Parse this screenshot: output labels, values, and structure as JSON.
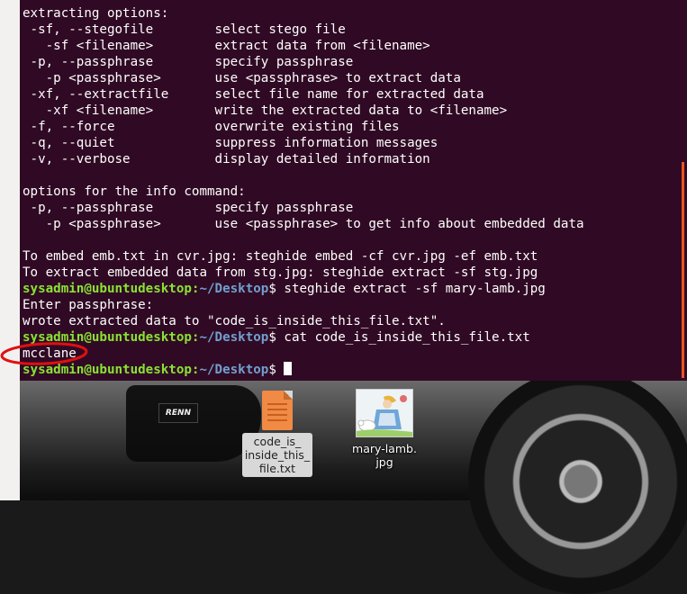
{
  "terminal": {
    "lines": [
      {
        "kind": "text",
        "text": "extracting options:"
      },
      {
        "kind": "text",
        "text": " -sf, --stegofile        select stego file"
      },
      {
        "kind": "text",
        "text": "   -sf <filename>        extract data from <filename>"
      },
      {
        "kind": "text",
        "text": " -p, --passphrase        specify passphrase"
      },
      {
        "kind": "text",
        "text": "   -p <passphrase>       use <passphrase> to extract data"
      },
      {
        "kind": "text",
        "text": " -xf, --extractfile      select file name for extracted data"
      },
      {
        "kind": "text",
        "text": "   -xf <filename>        write the extracted data to <filename>"
      },
      {
        "kind": "text",
        "text": " -f, --force             overwrite existing files"
      },
      {
        "kind": "text",
        "text": " -q, --quiet             suppress information messages"
      },
      {
        "kind": "text",
        "text": " -v, --verbose           display detailed information"
      },
      {
        "kind": "text",
        "text": ""
      },
      {
        "kind": "text",
        "text": "options for the info command:"
      },
      {
        "kind": "text",
        "text": " -p, --passphrase        specify passphrase"
      },
      {
        "kind": "text",
        "text": "   -p <passphrase>       use <passphrase> to get info about embedded data"
      },
      {
        "kind": "text",
        "text": ""
      },
      {
        "kind": "text",
        "text": "To embed emb.txt in cvr.jpg: steghide embed -cf cvr.jpg -ef emb.txt"
      },
      {
        "kind": "text",
        "text": "To extract embedded data from stg.jpg: steghide extract -sf stg.jpg"
      },
      {
        "kind": "prompt",
        "user": "sysadmin@ubuntudesktop",
        "path": "~/Desktop",
        "cmd": " steghide extract -sf mary-lamb.jpg"
      },
      {
        "kind": "text",
        "text": "Enter passphrase:"
      },
      {
        "kind": "text",
        "text": "wrote extracted data to \"code_is_inside_this_file.txt\"."
      },
      {
        "kind": "prompt",
        "user": "sysadmin@ubuntudesktop",
        "path": "~/Desktop",
        "cmd": " cat code_is_inside_this_file.txt"
      },
      {
        "kind": "text",
        "text": "mcclane"
      },
      {
        "kind": "prompt",
        "user": "sysadmin@ubuntudesktop",
        "path": "~/Desktop",
        "cmd": " ",
        "cursor": true
      }
    ]
  },
  "desktop": {
    "plate_text": "RENN",
    "icons": [
      {
        "label": "code_is_\ninside_this_\nfile.txt",
        "icon": "text-file-icon",
        "selected": true
      },
      {
        "label": "mary-lamb.\njpg",
        "icon": "image-thumbnail-icon",
        "selected": false
      }
    ]
  },
  "colors": {
    "terminal_bg": "#300a24",
    "prompt_user": "#8ae234",
    "prompt_path": "#729fcf",
    "annotation": "#e01010",
    "scroll_thumb": "#e95420"
  }
}
